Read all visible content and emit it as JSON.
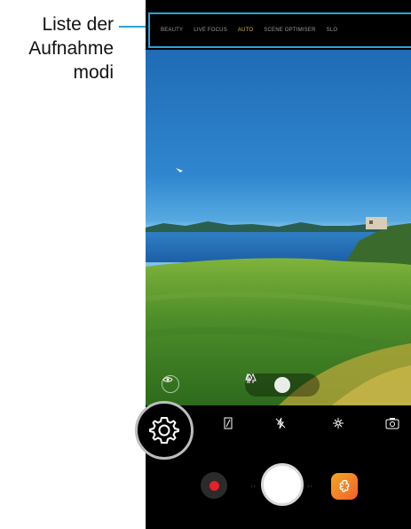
{
  "callout": {
    "lines": [
      "Liste der",
      "Aufnahme",
      "modi"
    ],
    "accent_color": "#2aa3d8"
  },
  "mode_bar": {
    "items": [
      {
        "label": "BEAUTY",
        "active": false
      },
      {
        "label": "LIVE FOCUS",
        "active": false
      },
      {
        "label": "AUTO",
        "active": true
      },
      {
        "label": "SCENE OPTIMISER",
        "active": false
      },
      {
        "label": "SLO",
        "active": false
      }
    ],
    "active_color": "#d7b640"
  },
  "viewfinder": {
    "eye_icon": "eye-icon",
    "filters": [
      {
        "icon": "trees-icon",
        "active": false
      },
      {
        "icon": "bush-icon",
        "active": true
      },
      {
        "icon": "tree-icon",
        "active": false
      }
    ]
  },
  "quick_settings": [
    {
      "icon": "settings-gear-icon"
    },
    {
      "icon": "aspect-ratio-icon"
    },
    {
      "icon": "flash-off-icon"
    },
    {
      "icon": "effects-sparkle-icon"
    },
    {
      "icon": "switch-camera-icon"
    }
  ],
  "controls": {
    "record_color": "#e8202a",
    "shutter_icon": "shutter-button",
    "gallery_icon": "gallery-flower-icon"
  }
}
